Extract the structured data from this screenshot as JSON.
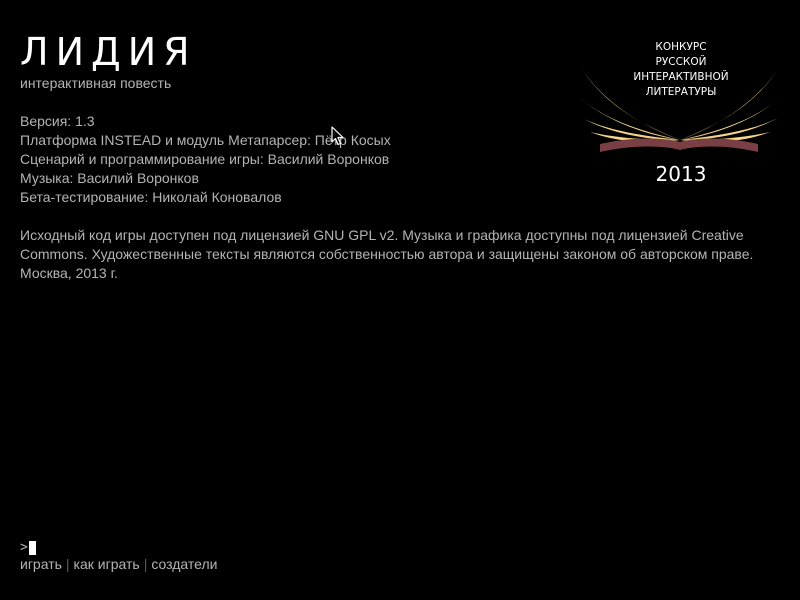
{
  "game": {
    "title": "ЛИДИЯ",
    "subtitle": "интерактивная повесть"
  },
  "credits": [
    "Версия: 1.3",
    "Платформа INSTEAD и модуль Метапарсер: Пётр Косых",
    "Сценарий и программирование игры: Василий Воронков",
    "Музыка: Василий Воронков",
    "Бета-тестирование: Николай Коновалов"
  ],
  "license": {
    "lines": [
      "Исходный код игры доступен под лицензией GNU GPL v2. Музыка и графика доступны под лицензией Creative",
      "Commons. Художественные тексты являются собственностью автора и защищены законом об авторском праве.",
      "Москва, 2013 г."
    ]
  },
  "badge": {
    "lines": [
      "КОНКУРС",
      "РУССКОЙ",
      "ИНТЕРАКТИВНОЙ",
      "ЛИТЕРАТУРЫ"
    ],
    "year": "2013",
    "colors": {
      "wings": "#f5d48a",
      "book": "#7a3f44"
    }
  },
  "prompt": {
    "symbol": ">"
  },
  "menu": {
    "play": "играть",
    "how_to_play": "как играть",
    "authors": "создатели",
    "separator": "|"
  },
  "colors": {
    "background": "#000000",
    "text": "#b4b4b4",
    "title": "#ffffff"
  },
  "icons": {
    "mouse": "mouse-pointer-icon",
    "badge": "wings-book-icon",
    "caret": "text-caret-icon"
  }
}
